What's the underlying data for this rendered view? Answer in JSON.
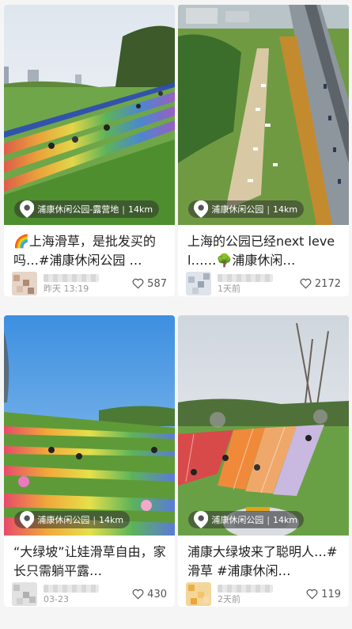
{
  "feed": {
    "cards": [
      {
        "location": "浦康休闲公园-露营地",
        "distance": "14km",
        "title": "🌈上海滑草，是批发买的吗…#浦康休闲公园 …",
        "date": "昨天 13:19",
        "likes": "587"
      },
      {
        "location": "浦康休闲公园",
        "distance": "14km",
        "title": "上海的公园已经next level……🌳浦康休闲…",
        "date": "1天前",
        "likes": "2172"
      },
      {
        "location": "浦康休闲公园",
        "distance": "14km",
        "title": "“大绿坡”让娃滑草自由，家长只需躺平露…",
        "date": "03-23",
        "likes": "430"
      },
      {
        "location": "浦康休闲公园",
        "distance": "14km",
        "title": "浦康大绿坡来了聪明人…#滑草 #浦康休闲…",
        "date": "2天前",
        "likes": "119"
      }
    ]
  },
  "colors": {
    "accent_green": "#3f8f2f",
    "text_main": "#222222",
    "text_muted": "#999999"
  }
}
